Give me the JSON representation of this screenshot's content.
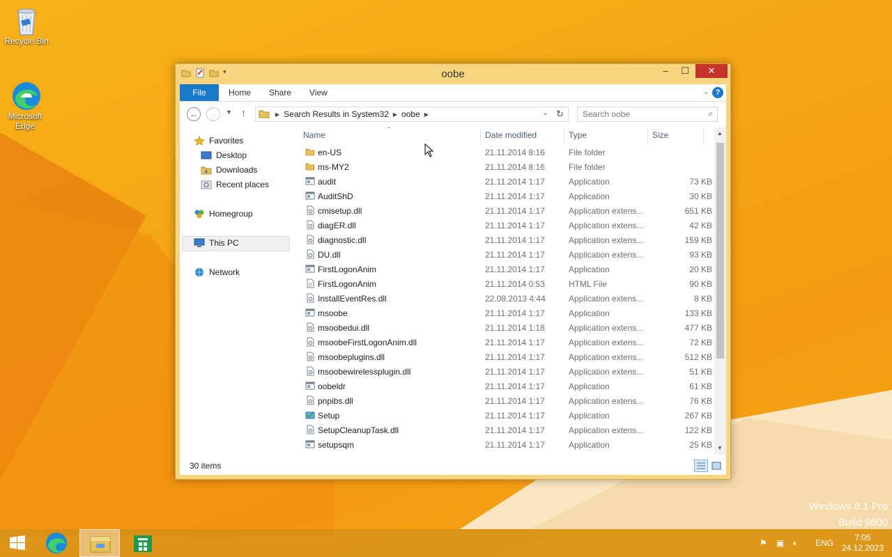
{
  "desktop": {
    "icons": [
      {
        "label": "Recycle Bin"
      },
      {
        "label": "Microsoft Edge"
      }
    ],
    "watermark": {
      "line1": "Windows 8.1 Pro",
      "line2": "Build 9600"
    }
  },
  "window": {
    "title": "oobe",
    "controls": {
      "minimize": "–",
      "maximize": "☐",
      "close": "✕"
    },
    "ribbon": {
      "tabs": [
        "File",
        "Home",
        "Share",
        "View"
      ],
      "help": "?"
    },
    "address": {
      "crumbs": [
        "Search Results in System32",
        "oobe"
      ]
    },
    "search": {
      "placeholder": "Search oobe"
    },
    "nav": {
      "favorites": "Favorites",
      "favorites_items": [
        "Desktop",
        "Downloads",
        "Recent places"
      ],
      "homegroup": "Homegroup",
      "thispc": "This PC",
      "network": "Network"
    },
    "columns": {
      "name": "Name",
      "date": "Date modified",
      "type": "Type",
      "size": "Size"
    },
    "rows": [
      {
        "name": "en-US",
        "date": "21.11.2014 8:16",
        "type": "File folder",
        "size": "",
        "icon": "folder-icon"
      },
      {
        "name": "ms-MY2",
        "date": "21.11.2014 8:16",
        "type": "File folder",
        "size": "",
        "icon": "folder-icon"
      },
      {
        "name": "audit",
        "date": "21.11.2014 1:17",
        "type": "Application",
        "size": "73 KB",
        "icon": "app-icon"
      },
      {
        "name": "AuditShD",
        "date": "21.11.2014 1:17",
        "type": "Application",
        "size": "30 KB",
        "icon": "app-icon"
      },
      {
        "name": "cmisetup.dll",
        "date": "21.11.2014 1:17",
        "type": "Application extens...",
        "size": "651 KB",
        "icon": "dll-icon"
      },
      {
        "name": "diagER.dll",
        "date": "21.11.2014 1:17",
        "type": "Application extens...",
        "size": "42 KB",
        "icon": "dll-icon"
      },
      {
        "name": "diagnostic.dll",
        "date": "21.11.2014 1:17",
        "type": "Application extens...",
        "size": "159 KB",
        "icon": "dll-icon"
      },
      {
        "name": "DU.dll",
        "date": "21.11.2014 1:17",
        "type": "Application extens...",
        "size": "93 KB",
        "icon": "dll-icon"
      },
      {
        "name": "FirstLogonAnim",
        "date": "21.11.2014 1:17",
        "type": "Application",
        "size": "20 KB",
        "icon": "app-icon"
      },
      {
        "name": "FirstLogonAnim",
        "date": "21.11.2014 0:53",
        "type": "HTML File",
        "size": "90 KB",
        "icon": "html-icon"
      },
      {
        "name": "InstallEventRes.dll",
        "date": "22.08.2013 4:44",
        "type": "Application extens...",
        "size": "8 KB",
        "icon": "dll-icon"
      },
      {
        "name": "msoobe",
        "date": "21.11.2014 1:17",
        "type": "Application",
        "size": "133 KB",
        "icon": "app-icon"
      },
      {
        "name": "msoobedui.dll",
        "date": "21.11.2014 1:18",
        "type": "Application extens...",
        "size": "477 KB",
        "icon": "dll-icon"
      },
      {
        "name": "msoobeFirstLogonAnim.dll",
        "date": "21.11.2014 1:17",
        "type": "Application extens...",
        "size": "72 KB",
        "icon": "dll-icon"
      },
      {
        "name": "msoobeplugins.dll",
        "date": "21.11.2014 1:17",
        "type": "Application extens...",
        "size": "512 KB",
        "icon": "dll-icon"
      },
      {
        "name": "msoobewirelessplugin.dll",
        "date": "21.11.2014 1:17",
        "type": "Application extens...",
        "size": "51 KB",
        "icon": "dll-icon"
      },
      {
        "name": "oobeldr",
        "date": "21.11.2014 1:17",
        "type": "Application",
        "size": "61 KB",
        "icon": "app-icon"
      },
      {
        "name": "pnpibs.dll",
        "date": "21.11.2014 1:17",
        "type": "Application extens...",
        "size": "76 KB",
        "icon": "dll-icon"
      },
      {
        "name": "Setup",
        "date": "21.11.2014 1:17",
        "type": "Application",
        "size": "267 KB",
        "icon": "setup-icon"
      },
      {
        "name": "SetupCleanupTask.dll",
        "date": "21.11.2014 1:17",
        "type": "Application extens...",
        "size": "122 KB",
        "icon": "dll-icon"
      },
      {
        "name": "setupsqm",
        "date": "21.11.2014 1:17",
        "type": "Application",
        "size": "25 KB",
        "icon": "app-icon"
      }
    ],
    "status": {
      "items": "30 items"
    }
  },
  "taskbar": {
    "tray": {
      "lang": "ENG",
      "time": "7:05",
      "date": "24.12.2023"
    }
  },
  "colors": {
    "accent": "#1979ca",
    "close": "#c7322b",
    "frame": "#f8d680"
  }
}
